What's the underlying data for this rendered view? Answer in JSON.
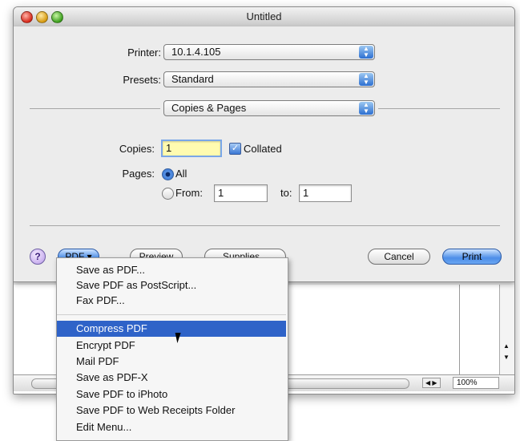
{
  "window": {
    "title": "Untitled"
  },
  "print": {
    "printer_label": "Printer:",
    "printer_value": "10.1.4.105",
    "presets_label": "Presets:",
    "presets_value": "Standard",
    "panel_value": "Copies & Pages",
    "copies_label": "Copies:",
    "copies_value": "1",
    "collated_label": "Collated",
    "collated_checked": true,
    "pages_label": "Pages:",
    "all_label": "All",
    "from_label": "From:",
    "from_value": "1",
    "to_label": "to:",
    "to_value": "1"
  },
  "buttons": {
    "help": "?",
    "pdf": "PDF ▾",
    "preview": "Preview",
    "supplies": "Supplies...",
    "cancel": "Cancel",
    "print": "Print"
  },
  "pdf_menu": {
    "items": [
      "Save as PDF...",
      "Save PDF as PostScript...",
      "Fax PDF...",
      "Compress PDF",
      "Encrypt PDF",
      "Mail PDF",
      "Save as PDF-X",
      "Save PDF to iPhoto",
      "Save PDF to Web Receipts Folder",
      "Edit Menu..."
    ],
    "selected": "Compress PDF"
  },
  "document": {
    "zoom": "100%"
  },
  "icons": {
    "popup_arrows": "updown-chevron-icon",
    "collated_check": "checkmark-icon",
    "cursor": "arrow-cursor-icon"
  },
  "colors": {
    "accent": "#2f63c8",
    "focus_field": "#fffbb0"
  }
}
